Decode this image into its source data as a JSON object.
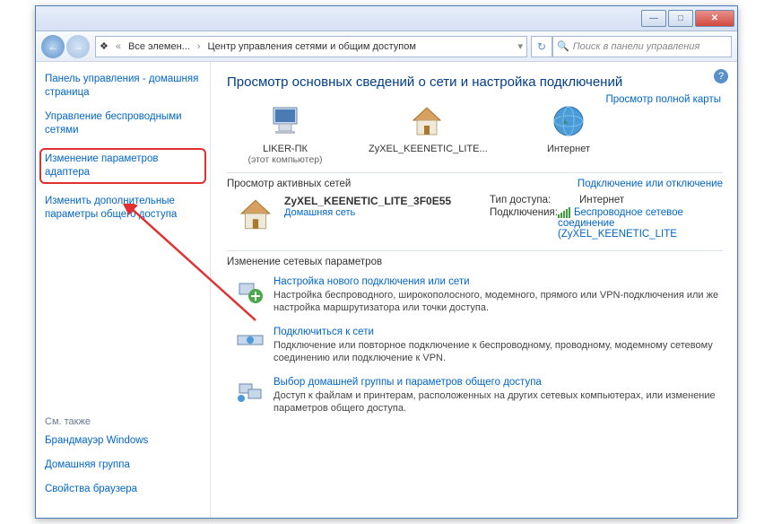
{
  "titlebar": {
    "min": "—",
    "max": "□",
    "close": "✕"
  },
  "nav": {
    "back": "←",
    "fwd": "→",
    "refresh": "↻",
    "crumb1": "Все элемен...",
    "crumb2": "Центр управления сетями и общим доступом"
  },
  "search": {
    "placeholder": "Поиск в панели управления"
  },
  "sidebar": {
    "home": "Панель управления - домашняя страница",
    "wireless": "Управление беспроводными сетями",
    "adapter": "Изменение параметров адаптера",
    "sharing": "Изменить дополнительные параметры общего доступа",
    "seealso": "См. также",
    "firewall": "Брандмауэр Windows",
    "homegroup": "Домашняя группа",
    "browser": "Свойства браузера"
  },
  "main": {
    "title": "Просмотр основных сведений о сети и настройка подключений",
    "mapfull": "Просмотр полной карты",
    "pc": "LIKER-ПК",
    "pcsub": "(этот компьютер)",
    "router": "ZyXEL_KEENETIC_LITE...",
    "internet": "Интернет",
    "activenets": "Просмотр активных сетей",
    "connectdisc": "Подключение или отключение",
    "netname": "ZyXEL_KEENETIC_LITE_3F0E55",
    "homenet": "Домашняя сеть",
    "accesstype": "Тип доступа:",
    "accessval": "Интернет",
    "connections": "Подключения:",
    "connval": "Беспроводное сетевое соединение (ZyXEL_KEENETIC_LITE",
    "changeparams": "Изменение сетевых параметров",
    "t1": "Настройка нового подключения или сети",
    "t1d": "Настройка беспроводного, широкополосного, модемного, прямого или VPN-подключения или же настройка маршрутизатора или точки доступа.",
    "t2": "Подключиться к сети",
    "t2d": "Подключение или повторное подключение к беспроводному, проводному, модемному сетевому соединению или подключение к VPN.",
    "t3": "Выбор домашней группы и параметров общего доступа",
    "t3d": "Доступ к файлам и принтерам, расположенных на других сетевых компьютерах, или изменение параметров общего доступа."
  }
}
